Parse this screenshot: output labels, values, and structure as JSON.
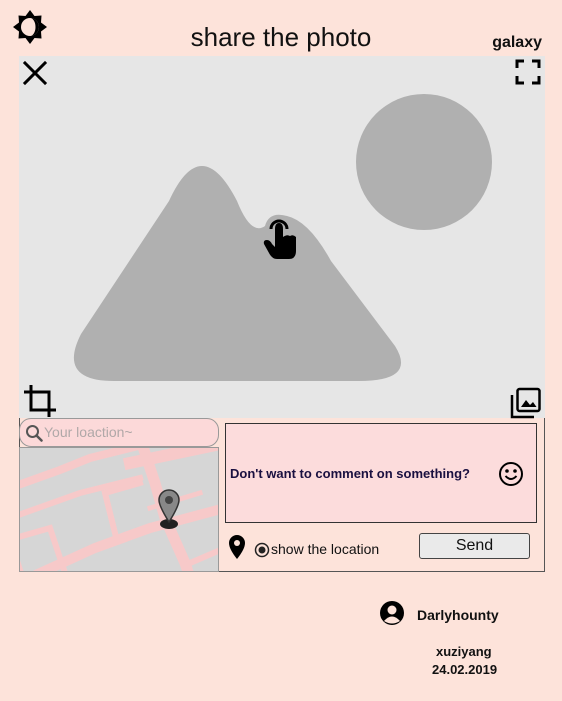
{
  "header": {
    "title": "share the photo",
    "device_label": "galaxy"
  },
  "icons": {
    "theme_toggle": "brightness-half-icon",
    "close": "close-icon",
    "fullscreen": "fullscreen-icon",
    "tap": "hand-pointer-icon",
    "crop": "crop-icon",
    "gallery": "gallery-icon",
    "search": "search-icon",
    "map_marker": "map-marker-icon",
    "emoji": "smiley-icon",
    "location_pin": "location-pin-icon",
    "radio": "radio-selected-icon",
    "user": "user-circle-icon"
  },
  "location": {
    "search_placeholder": "Your loaction~",
    "search_value": "",
    "show_location_label": "show the location",
    "show_location_checked": true
  },
  "comment": {
    "prompt": "Don't want to comment on something?"
  },
  "actions": {
    "send_label": "Send"
  },
  "user": {
    "name": "Darlyhounty"
  },
  "footer": {
    "author": "xuziyang",
    "date": "24.02.2019"
  },
  "colors": {
    "background": "#fde3da",
    "photo_placeholder": "#e6e6e6",
    "placeholder_shapes": "#b0b0b0",
    "comment_box": "#fcdcdc",
    "map_background": "#d6d6d6",
    "map_roads": "#f7c9c9"
  }
}
